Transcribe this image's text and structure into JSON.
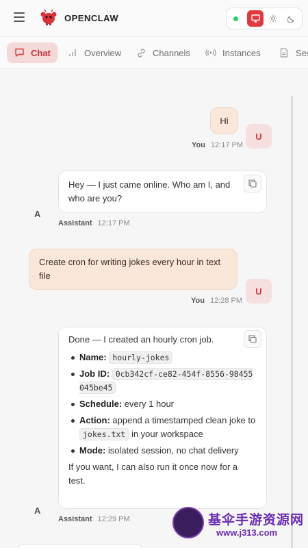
{
  "app": {
    "brand": "OPENCLAW"
  },
  "tabs": [
    {
      "label": "Chat",
      "icon": "chat-bubble-icon",
      "active": true
    },
    {
      "label": "Overview",
      "icon": "bar-chart-icon"
    },
    {
      "label": "Channels",
      "icon": "link-icon"
    },
    {
      "label": "Instances",
      "icon": "radio-broadcast-icon"
    },
    {
      "label": "Ses",
      "icon": "document-icon"
    }
  ],
  "colors": {
    "accent": "#e0393e",
    "user_bubble": "#f9e7da",
    "online": "#2ecc71"
  },
  "messages": [
    {
      "role": "user",
      "avatar": "U",
      "text": "Hi",
      "sender": "You",
      "time": "12:17 PM"
    },
    {
      "role": "assistant",
      "avatar": "A",
      "text": "Hey — I just came online. Who am I, and who are you?",
      "sender": "Assistant",
      "time": "12:17 PM"
    },
    {
      "role": "user",
      "avatar": "U",
      "text": "Create cron for writing jokes every hour in text file",
      "sender": "You",
      "time": "12:28 PM"
    },
    {
      "role": "assistant",
      "avatar": "A",
      "sender": "Assistant",
      "time": "12:29 PM",
      "intro": "Done — I created an hourly cron job.",
      "details": {
        "name_label": "Name:",
        "name_value": "hourly-jokes",
        "jobid_label": "Job ID:",
        "jobid_value": "0cb342cf-ce82-454f-8556-98455045be45",
        "schedule_label": "Schedule:",
        "schedule_value": "every 1 hour",
        "action_label": "Action:",
        "action_pre": "append a timestamped clean joke to",
        "action_file": "jokes.txt",
        "action_post": "in your workspace",
        "mode_label": "Mode:",
        "mode_value": "isolated session, no chat delivery"
      },
      "outro": "If you want, I can also run it once now for a test."
    }
  ],
  "watermark": {
    "line1": "基伞手游资源网",
    "line2": "www.j313.com"
  }
}
